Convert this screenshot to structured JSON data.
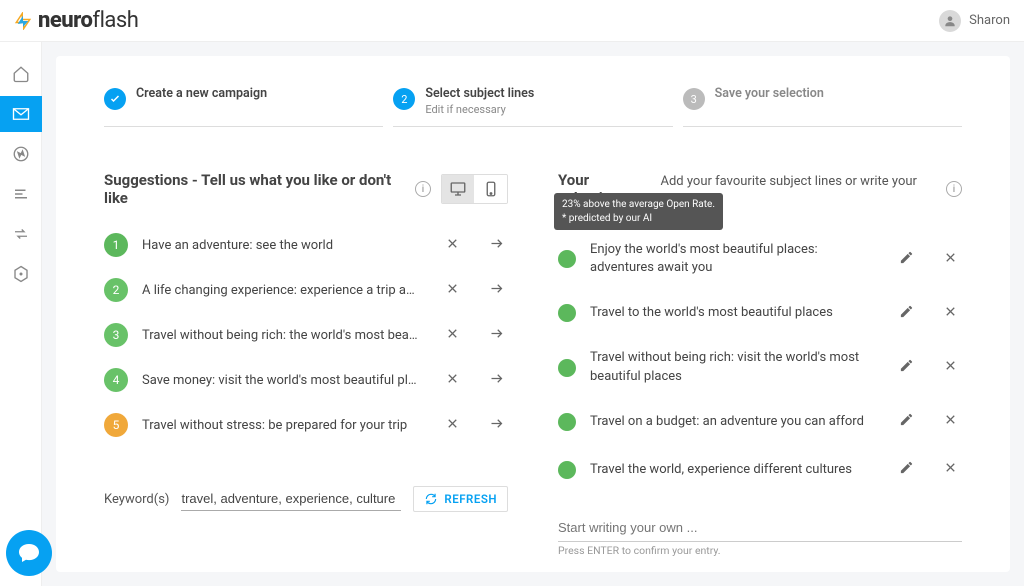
{
  "header": {
    "logo_prefix": "neuro",
    "logo_suffix": "flash",
    "user_name": "Sharon"
  },
  "steps": [
    {
      "title": "Create a new campaign",
      "subtitle": "",
      "state": "done"
    },
    {
      "title": "Select subject lines",
      "subtitle": "Edit if necessary",
      "state": "active",
      "number": "2"
    },
    {
      "title": "Save your selection",
      "subtitle": "",
      "state": "inactive",
      "number": "3"
    }
  ],
  "suggestions": {
    "title": "Suggestions - Tell us what you like or don't like",
    "items": [
      {
        "num": "1",
        "color": "#5cb85c",
        "text": "Have an adventure: see the world"
      },
      {
        "num": "2",
        "color": "#68c268",
        "text": "A life changing experience: experience a trip abroad"
      },
      {
        "num": "3",
        "color": "#68c268",
        "text": "Travel without being rich: the world's most beautiful places"
      },
      {
        "num": "4",
        "color": "#68c268",
        "text": "Save money: visit the world's most beautiful places"
      },
      {
        "num": "5",
        "color": "#f0a83a",
        "text": "Travel without stress: be prepared for your trip"
      }
    ]
  },
  "keywords": {
    "label": "Keyword(s)",
    "value": "travel, adventure, experience, culture",
    "refresh_label": "REFRESH"
  },
  "selection": {
    "title": "Your selection",
    "subtitle": "Add your favourite subject lines or write your own.",
    "tooltip_line1": "23% above the average Open Rate.",
    "tooltip_line2": "* predicted by our AI",
    "items": [
      {
        "color": "#5cb85c",
        "text": "Enjoy the world's most beautiful places: adventures await you"
      },
      {
        "color": "#5cb85c",
        "text": "Travel to the world's most beautiful places"
      },
      {
        "color": "#5cb85c",
        "text": "Travel without being rich: visit the world's most beautiful places"
      },
      {
        "color": "#5cb85c",
        "text": "Travel on a budget: an adventure you can afford"
      },
      {
        "color": "#5cb85c",
        "text": "Travel the world, experience different cultures"
      }
    ],
    "write_placeholder": "Start writing your own ...",
    "write_hint": "Press ENTER to confirm your entry."
  }
}
